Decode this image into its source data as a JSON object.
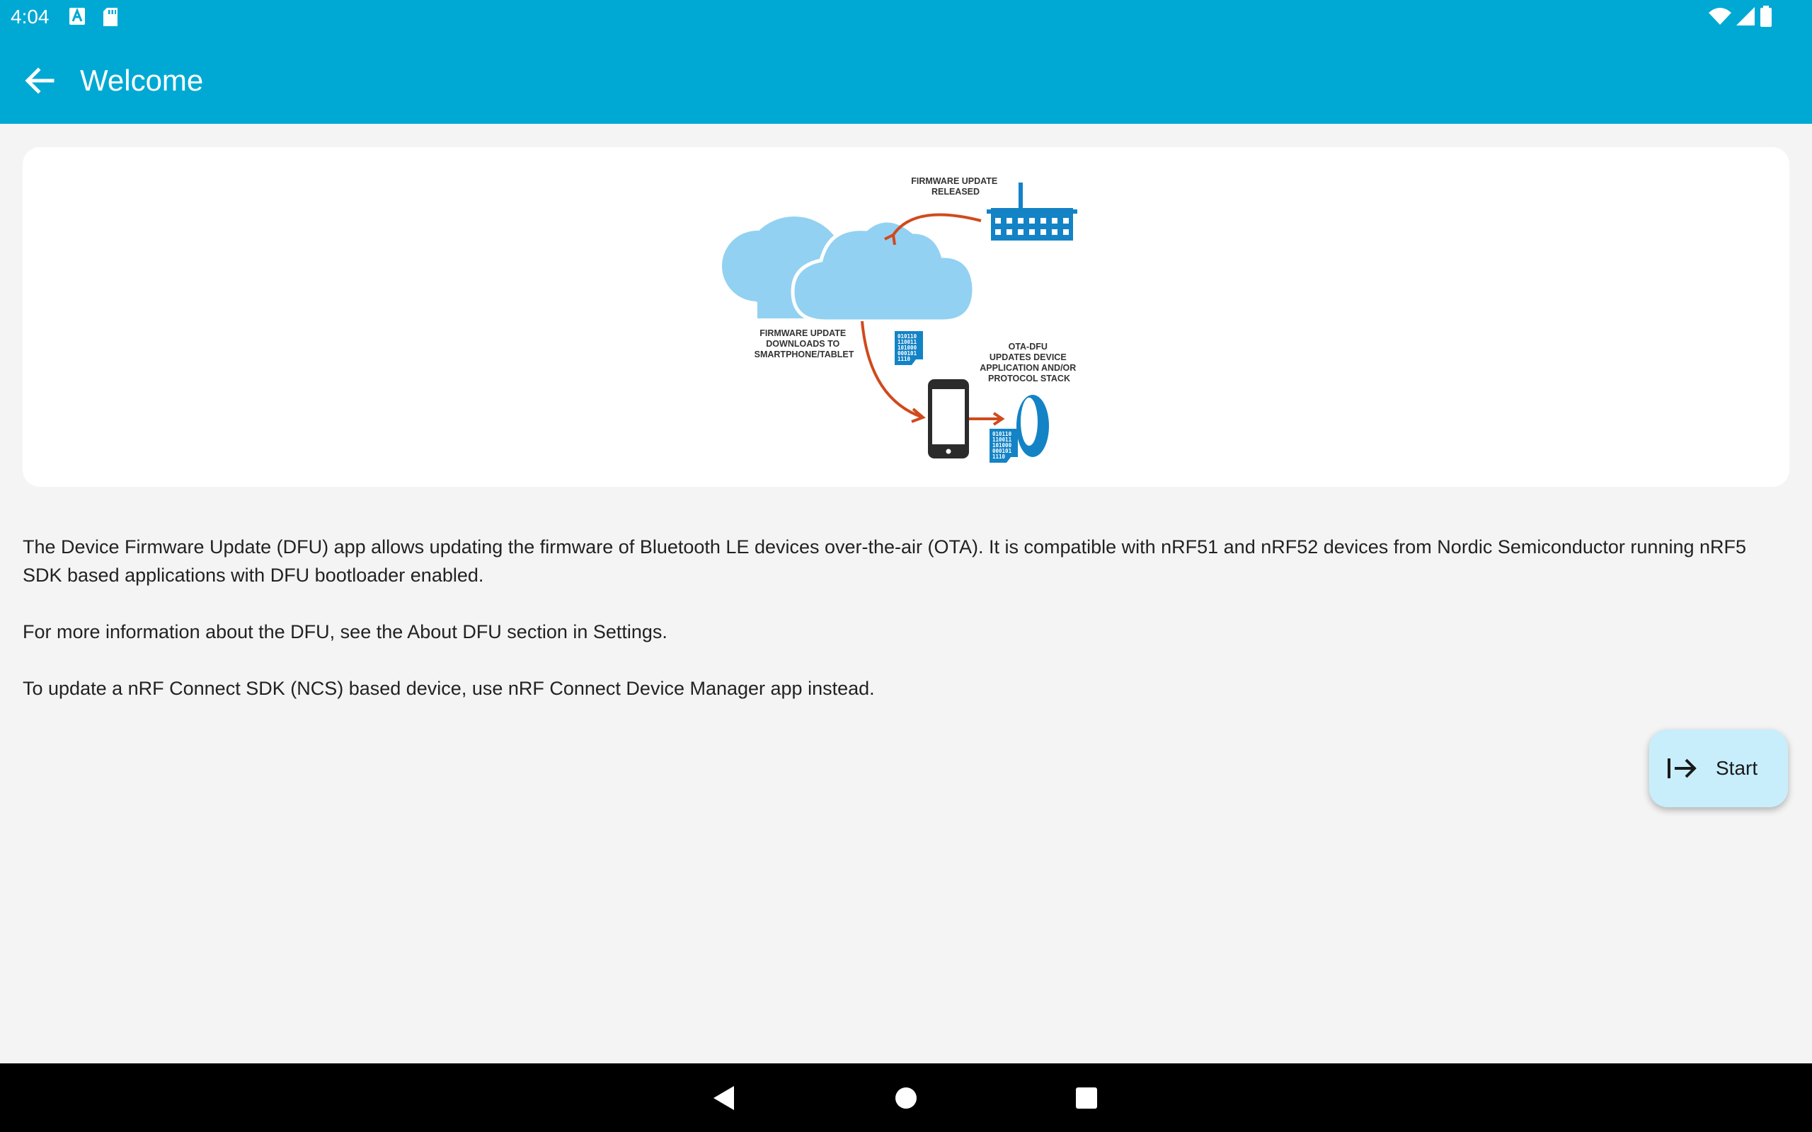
{
  "status_bar": {
    "time": "4:04",
    "left_icons": [
      "a-badge-icon",
      "sd-card-icon"
    ],
    "right_icons": [
      "wifi-icon",
      "signal-icon",
      "battery-icon"
    ]
  },
  "app_bar": {
    "title": "Welcome",
    "back_icon": "arrow-left-icon",
    "color": "#00a9d4"
  },
  "illustration": {
    "label_released": [
      "FIRMWARE UPDATE",
      "RELEASED"
    ],
    "label_downloads": [
      "FIRMWARE UPDATE",
      "DOWNLOADS TO",
      "SMARTPHONE/TABLET"
    ],
    "label_ota": [
      "OTA-DFU",
      "UPDATES DEVICE",
      "APPLICATION AND/OR",
      "PROTOCOL STACK"
    ],
    "binary_lines": [
      "010110",
      "110011",
      "101000",
      "000101",
      "1110"
    ]
  },
  "content": {
    "paragraph1": "The Device Firmware Update (DFU) app allows updating the firmware of Bluetooth LE devices over-the-air (OTA). It is compatible with nRF51 and nRF52 devices from Nordic Semiconductor running nRF5 SDK based applications with DFU bootloader enabled.",
    "paragraph2": "For more information about the DFU, see the About DFU section in Settings.",
    "paragraph3": "To update a nRF Connect SDK (NCS) based device, use nRF Connect Device Manager app instead."
  },
  "fab": {
    "label": "Start",
    "icon": "start-arrow-icon",
    "color": "#c8eefc"
  },
  "nav_bar": {
    "buttons": [
      "back-triangle-icon",
      "home-circle-icon",
      "recents-square-icon"
    ]
  }
}
